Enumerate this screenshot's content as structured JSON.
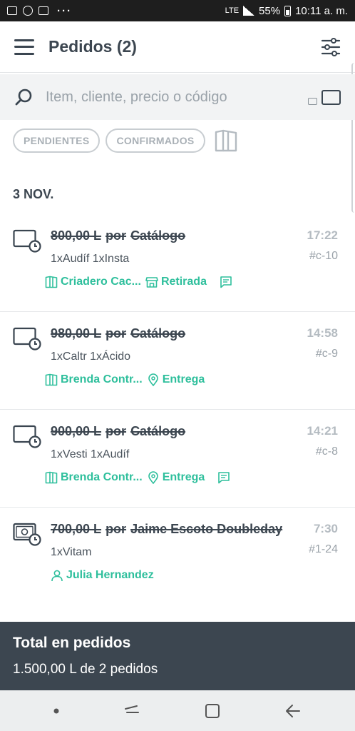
{
  "status_bar": {
    "battery": "55%",
    "time": "10:11 a. m.",
    "network": "LTE"
  },
  "app_bar": {
    "title": "Pedidos (2)"
  },
  "search": {
    "placeholder": "Item, cliente, precio o código"
  },
  "filters": {
    "pending": "PENDIENTES",
    "confirmed": "CONFIRMADOS"
  },
  "date_header": "3 NOV.",
  "orders": [
    {
      "amount": "800,00 L",
      "por": "por",
      "source": "Catálogo",
      "time": "17:22",
      "code": "#c-10",
      "items": "1xAudíf 1xInsta",
      "customer": "Criadero Cac...",
      "delivery": "Retirada",
      "payment_icon": "card-clock-icon",
      "has_chat": true
    },
    {
      "amount": "980,00 L",
      "por": "por",
      "source": "Catálogo",
      "time": "14:58",
      "code": "#c-9",
      "items": "1xCaltr 1xÁcido",
      "customer": "Brenda Contr...",
      "delivery": "Entrega",
      "payment_icon": "card-clock-icon",
      "has_chat": false
    },
    {
      "amount": "900,00 L",
      "por": "por",
      "source": "Catálogo",
      "time": "14:21",
      "code": "#c-8",
      "items": "1xVesti 1xAudíf",
      "customer": "Brenda Contr...",
      "delivery": "Entrega",
      "payment_icon": "card-clock-icon",
      "has_chat": true
    },
    {
      "amount": "700,00 L",
      "por": "por",
      "source": "Jaime Escoto Doubleday",
      "time": "7:30",
      "code": "#1-24",
      "items": "1xVitam",
      "customer": "Julia Hernandez",
      "payment_icon": "cash-clock-icon",
      "has_chat": false
    }
  ],
  "total": {
    "title": "Total en pedidos",
    "summary": "1.500,00 L de 2 pedidos"
  },
  "colors": {
    "accent": "#2ebf9c",
    "dark": "#3c4650",
    "muted": "#b4bbc1"
  }
}
